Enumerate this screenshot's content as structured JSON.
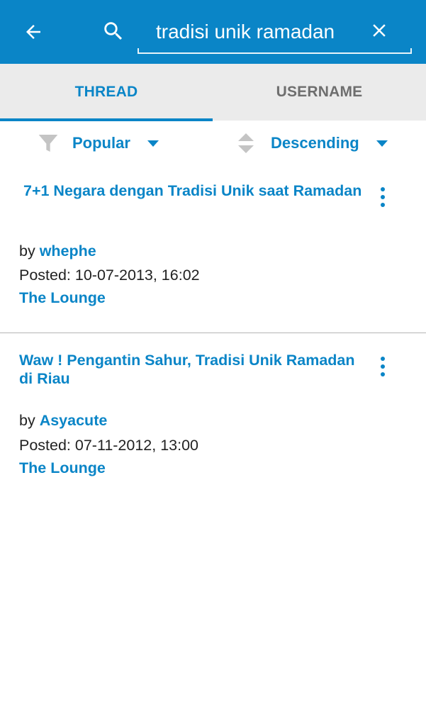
{
  "header": {
    "back_icon": "arrow-left-icon",
    "search_icon": "search-icon",
    "search_value": "tradisi unik ramadan",
    "clear_icon": "close-icon",
    "color": "#0a85c7"
  },
  "tabs": [
    {
      "label": "THREAD",
      "active": true
    },
    {
      "label": "USERNAME",
      "active": false
    }
  ],
  "sort": {
    "filter_icon": "funnel-icon",
    "filter_label": "Popular",
    "order_icon": "sort-icon",
    "order_label": "Descending"
  },
  "threads": [
    {
      "title": " 7+1 Negara dengan Tradisi Unik saat Ramadan",
      "by_label": "by",
      "author": "whephe",
      "posted": "Posted: 10-07-2013, 16:02",
      "forum": "The Lounge"
    },
    {
      "title": "Waw ! Pengantin Sahur, Tradisi Unik Ramadan di Riau",
      "by_label": "by",
      "author": "Asyacute",
      "posted": "Posted: 07-11-2012, 13:00",
      "forum": "The Lounge"
    }
  ]
}
